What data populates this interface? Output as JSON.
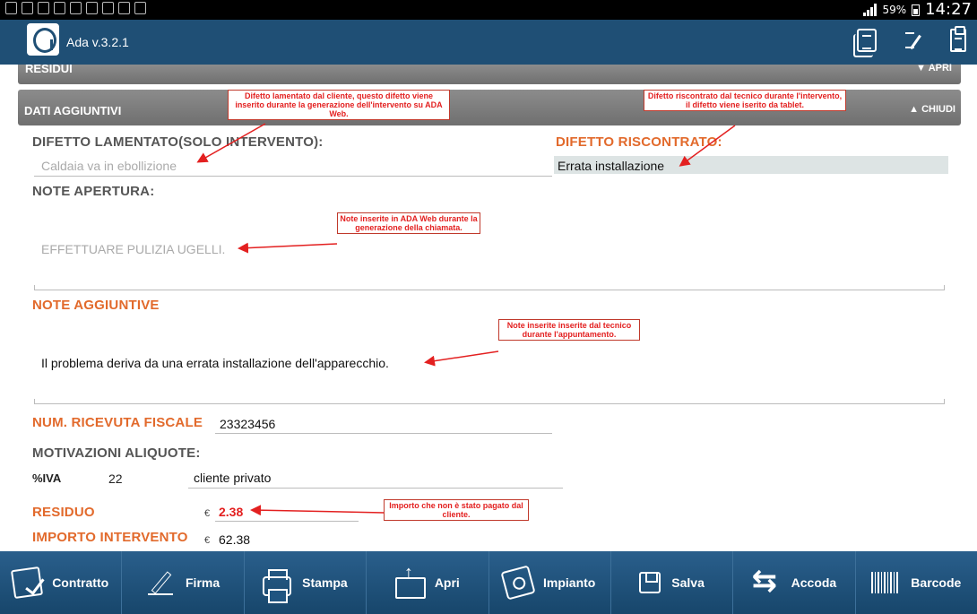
{
  "app": {
    "title": "Ada v.3.2.1"
  },
  "status_bar": {
    "battery": "59%",
    "time": "14:27"
  },
  "sections": {
    "residui": {
      "label": "RESIDUI",
      "toggle": "▼ APRI"
    },
    "dati_aggiuntivi": {
      "label": "DATI AGGIUNTIVI",
      "toggle": "▲ CHIUDI"
    }
  },
  "form": {
    "difetto_lamentato": {
      "label": "DIFETTO LAMENTATO(SOLO INTERVENTO):",
      "value": "Caldaia va in ebollizione"
    },
    "difetto_riscontrato": {
      "label": "DIFETTO RISCONTRATO:",
      "value": "Errata installazione"
    },
    "note_apertura": {
      "label": "NOTE APERTURA:",
      "value": "EFFETTUARE PULIZIA UGELLI."
    },
    "note_aggiuntive": {
      "label": "NOTE AGGIUNTIVE",
      "value": "Il problema deriva da una errata installazione dell'apparecchio."
    },
    "num_ricevuta": {
      "label": "NUM. RICEVUTA FISCALE",
      "value": "23323456"
    },
    "motivazioni": {
      "label": "MOTIVAZIONI ALIQUOTE:"
    },
    "iva": {
      "label": "%IVA",
      "value": "22",
      "description": "cliente privato"
    },
    "residuo": {
      "label": "RESIDUO",
      "currency": "€",
      "value": "2.38"
    },
    "importo": {
      "label": "IMPORTO INTERVENTO",
      "currency": "€",
      "value": "62.38"
    }
  },
  "annotations": {
    "difetto_lamentato": "Difetto lamentato dal cliente, questo difetto viene inserito durante la generazione dell'intervento su ADA Web.",
    "difetto_riscontrato": "Difetto riscontrato dal tecnico durante l'intervento, il difetto viene iserito da tablet.",
    "note_apertura": "Note inserite in ADA Web durante la generazione della chiamata.",
    "note_aggiuntive": "Note inserite inserite dal tecnico durante l'appuntamento.",
    "residuo": "Importo che non è stato pagato dal cliente."
  },
  "toolbar": [
    {
      "label": "Contratto",
      "icon": "contract-icon"
    },
    {
      "label": "Firma",
      "icon": "signature-icon"
    },
    {
      "label": "Stampa",
      "icon": "printer-icon"
    },
    {
      "label": "Apri",
      "icon": "open-folder-icon"
    },
    {
      "label": "Impianto",
      "icon": "plant-icon"
    },
    {
      "label": "Salva",
      "icon": "save-icon"
    },
    {
      "label": "Accoda",
      "icon": "queue-arrows-icon"
    },
    {
      "label": "Barcode",
      "icon": "barcode-icon"
    }
  ],
  "colors": {
    "appbar": "#1f4f75",
    "accent_orange": "#e26a2c",
    "annotation_red": "#e32020",
    "section_gray": "#7a7a7a"
  }
}
